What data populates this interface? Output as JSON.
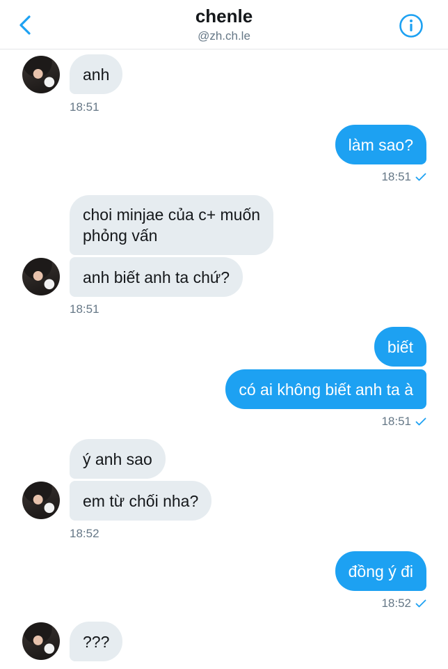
{
  "header": {
    "name": "chenle",
    "handle": "@zh.ch.le"
  },
  "messages": [
    {
      "text": "anh",
      "time": "18:51"
    },
    {
      "text": "làm sao?",
      "time": "18:51"
    },
    {
      "text": "choi minjae của c+ muốn",
      "text2": "phỏng vấn"
    },
    {
      "text": "anh biết anh ta chứ?",
      "time": "18:51"
    },
    {
      "text": "biết"
    },
    {
      "text": "có ai không biết anh ta à",
      "time": "18:51"
    },
    {
      "text": "ý anh sao"
    },
    {
      "text": "em từ chối nha?",
      "time": "18:52"
    },
    {
      "text": "đồng ý đi",
      "time": "18:52"
    },
    {
      "text": "???"
    }
  ],
  "icons": {
    "back": "chevron-left-icon",
    "info": "info-icon",
    "read": "check-icon"
  },
  "colors": {
    "accent": "#1da1f2",
    "incoming_bubble": "#e6ecf0"
  }
}
